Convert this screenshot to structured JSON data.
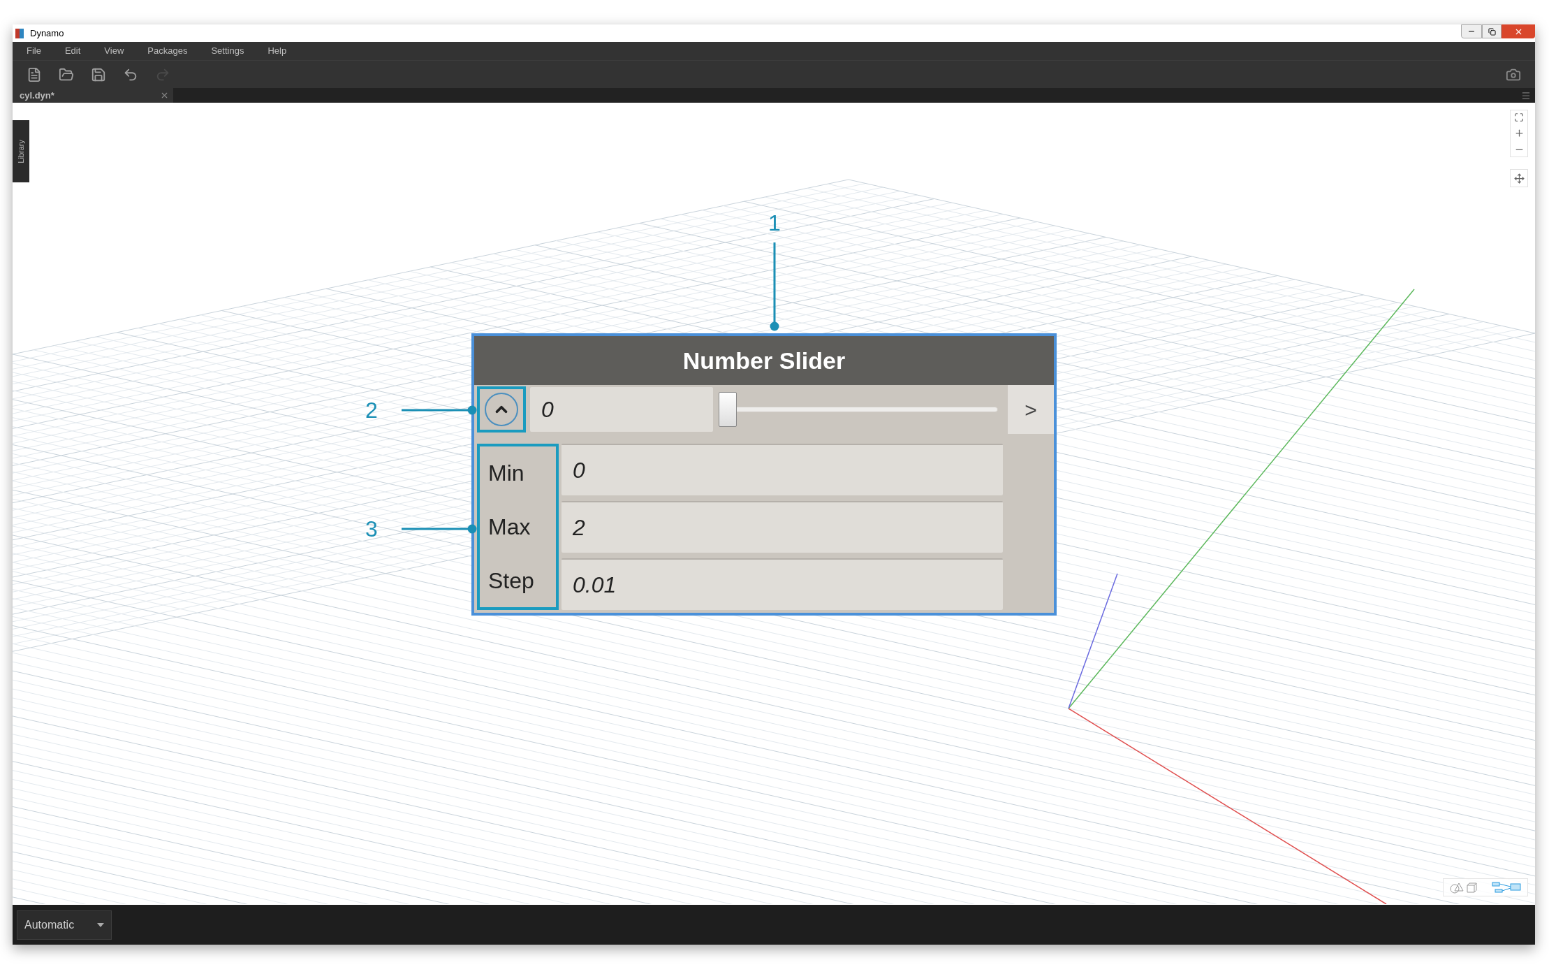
{
  "window": {
    "title": "Dynamo"
  },
  "menu": [
    "File",
    "Edit",
    "View",
    "Packages",
    "Settings",
    "Help"
  ],
  "toolbar": [
    {
      "kind": "new",
      "disabled": false
    },
    {
      "kind": "open",
      "disabled": false
    },
    {
      "kind": "save",
      "disabled": false
    },
    {
      "kind": "undo",
      "disabled": false
    },
    {
      "kind": "redo",
      "disabled": true
    }
  ],
  "tabs": [
    {
      "label": "cyl.dyn*"
    }
  ],
  "library_tab": "Library",
  "node": {
    "title": "Number Slider",
    "value": "0",
    "slider": {
      "level": 0
    },
    "next_button": ">",
    "expanded": true,
    "fields": [
      {
        "label": "Min",
        "value": "0"
      },
      {
        "label": "Max",
        "value": "2"
      },
      {
        "label": "Step",
        "value": "0.01"
      }
    ]
  },
  "callouts": [
    "1",
    "2",
    "3"
  ],
  "view_toggle": [
    {
      "kind": "geometry",
      "selected": false
    },
    {
      "kind": "graph",
      "selected": true
    }
  ],
  "status_bar": {
    "run_mode": "Automatic"
  }
}
